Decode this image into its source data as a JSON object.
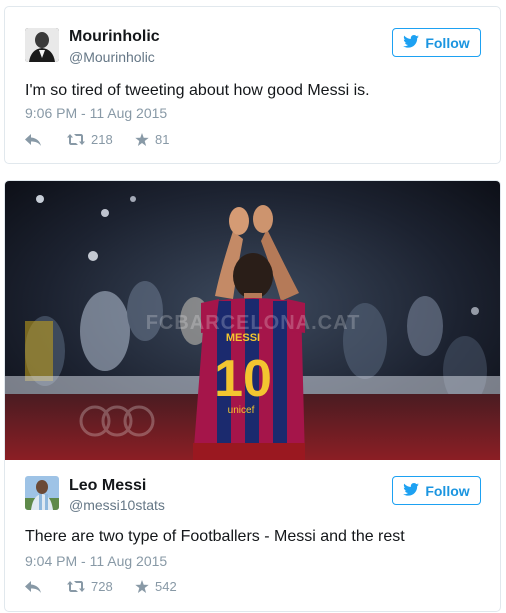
{
  "tweets": [
    {
      "name": "Mourinholic",
      "handle": "@Mourinholic",
      "follow_label": "Follow",
      "text": "I'm so tired of tweeting about how good Messi is.",
      "timestamp": "9:06 PM - 11 Aug 2015",
      "retweets": "218",
      "likes": "81"
    },
    {
      "photo": {
        "watermark": "FCBARCELONA.CAT",
        "jersey_name": "MESSI",
        "jersey_number": "10",
        "jersey_sponsor": "unicef"
      },
      "name": "Leo Messi",
      "handle": "@messi10stats",
      "follow_label": "Follow",
      "text": "There are two type of Footballers - Messi and the rest",
      "timestamp": "9:04 PM - 11 Aug 2015",
      "retweets": "728",
      "likes": "542"
    }
  ],
  "colors": {
    "accent": "#1da1f2",
    "muted": "#8899a6",
    "border": "#e1e8ed"
  }
}
